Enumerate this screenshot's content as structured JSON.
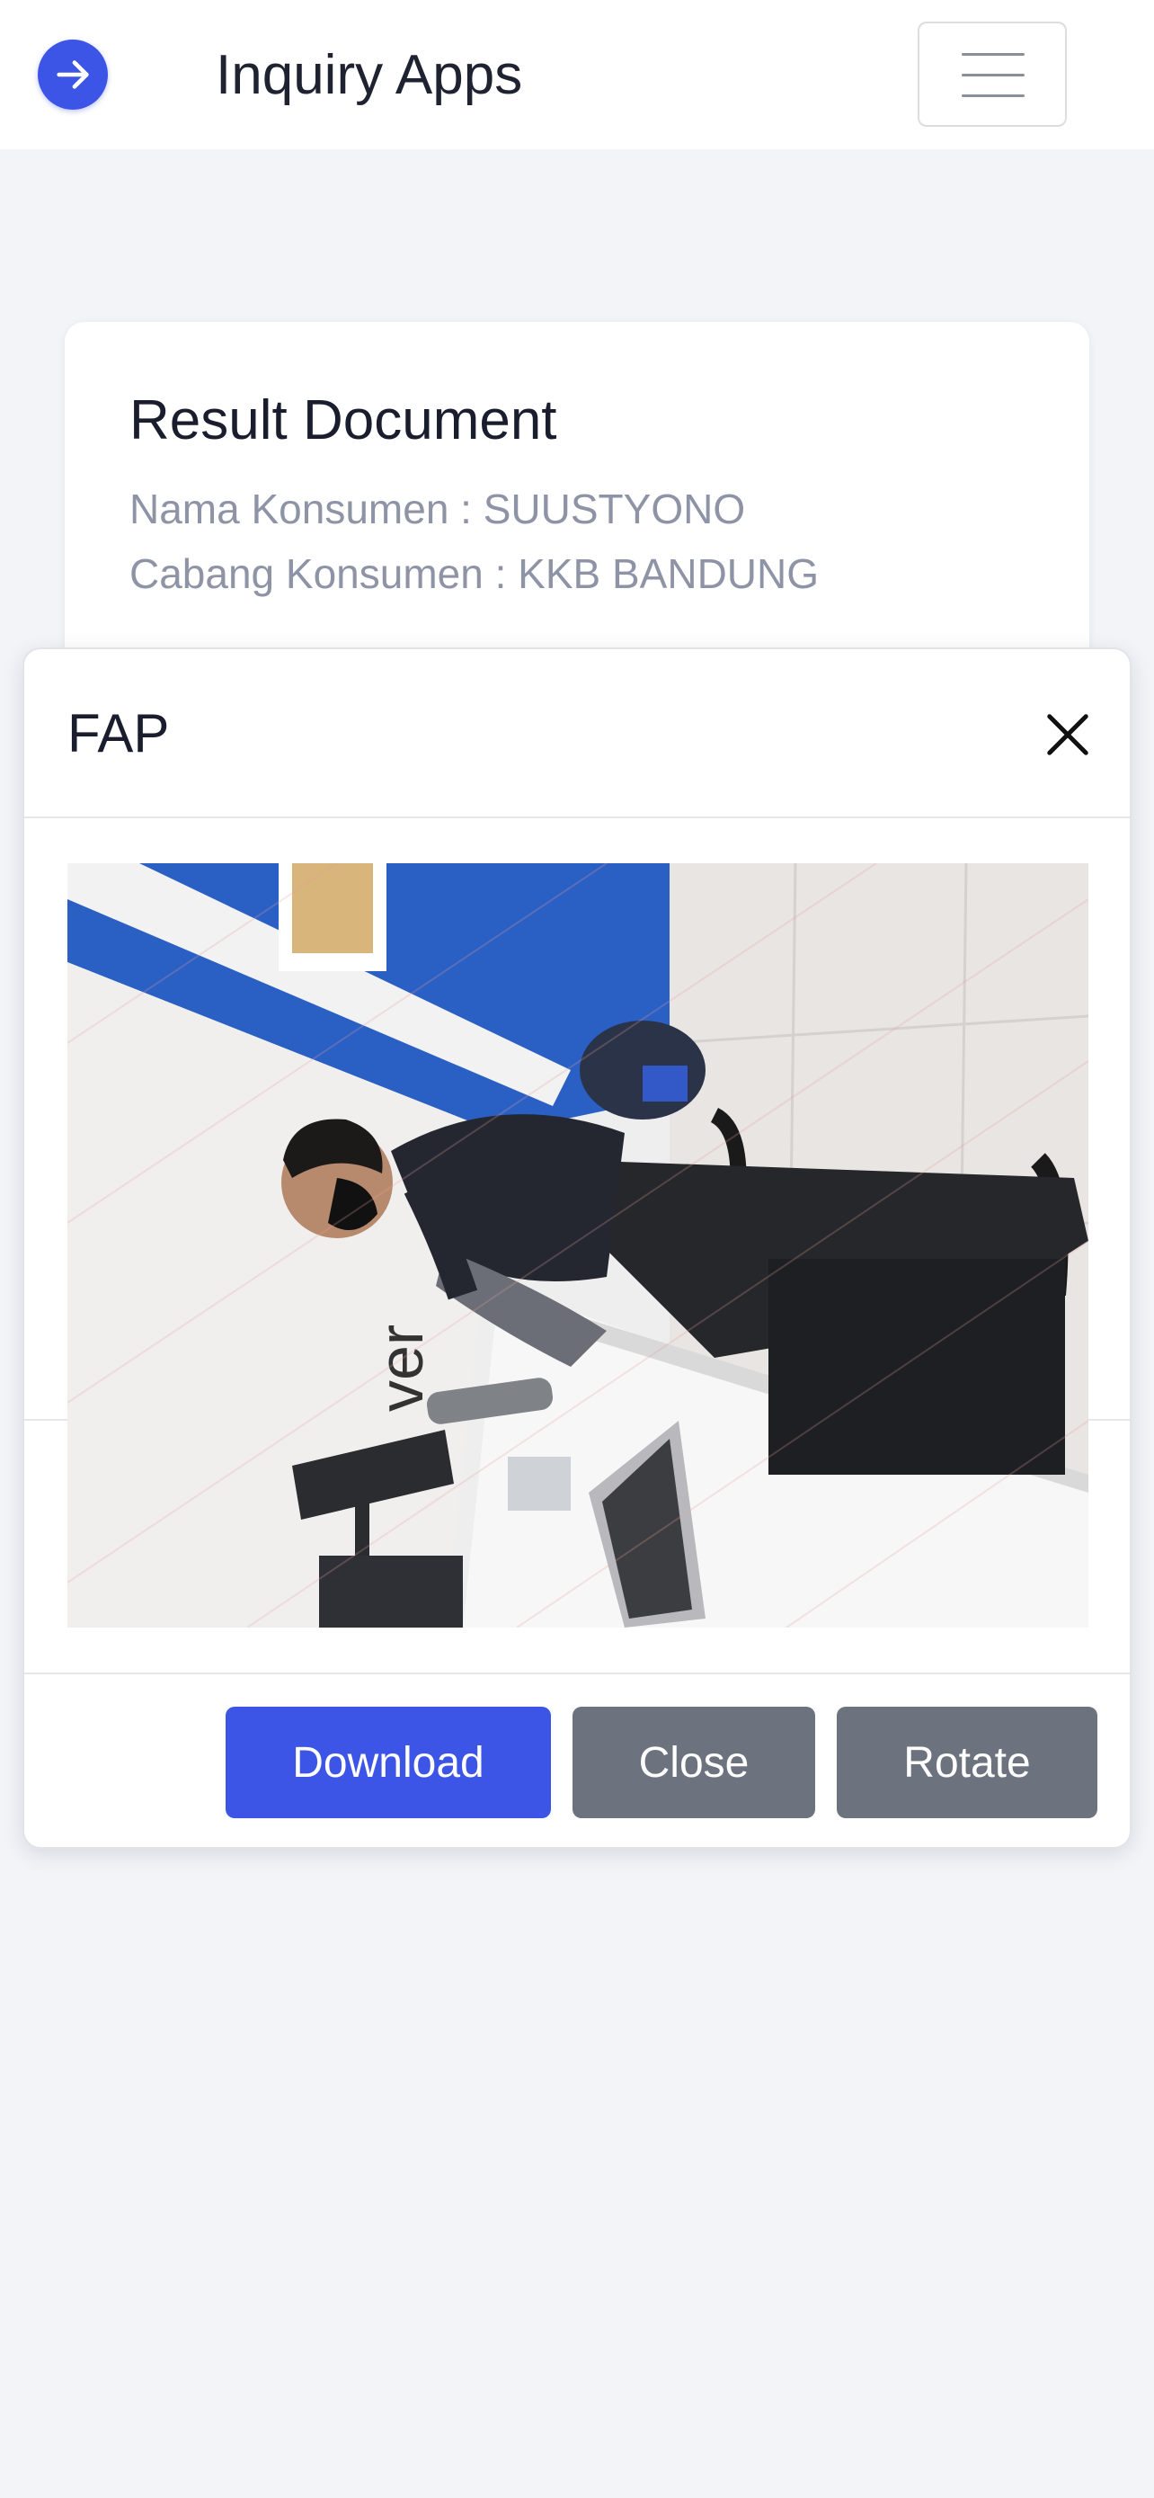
{
  "header": {
    "title": "Inquiry Apps",
    "logo_icon": "arrow-right-icon",
    "menu_icon": "hamburger-menu-icon"
  },
  "result": {
    "title": "Result Document",
    "customer_name_line": "Nama Konsumen : SUUSTYONO",
    "customer_branch_line": "Cabang Konsumen : KKB BANDUNG"
  },
  "modal": {
    "title": "FAP",
    "close_icon": "close-x-icon",
    "image_text": "ver",
    "buttons": {
      "download": "Download",
      "close": "Close",
      "rotate": "Rotate"
    }
  },
  "colors": {
    "primary": "#3d55e6",
    "secondary": "#6c737e",
    "background": "#f3f4f8",
    "muted_text": "#8e93a6"
  }
}
